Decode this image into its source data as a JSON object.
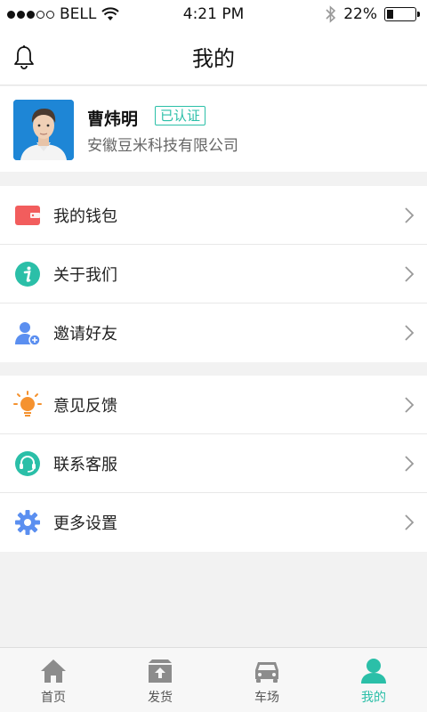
{
  "status_bar": {
    "carrier": "BELL",
    "time": "4:21 PM",
    "battery": "22%",
    "battery_level": 0.22
  },
  "header": {
    "title": "我的"
  },
  "profile": {
    "name": "曹炜明",
    "badge": "已认证",
    "company": "安徽豆米科技有限公司"
  },
  "menu": {
    "group1": [
      {
        "label": "我的钱包",
        "icon": "wallet-icon",
        "color": "#f25d5d"
      },
      {
        "label": "关于我们",
        "icon": "info-icon",
        "color": "#2bbfa8"
      },
      {
        "label": "邀请好友",
        "icon": "invite-user-icon",
        "color": "#5b8ff0"
      }
    ],
    "group2": [
      {
        "label": "意见反馈",
        "icon": "lightbulb-icon",
        "color": "#f5922f"
      },
      {
        "label": "联系客服",
        "icon": "headset-icon",
        "color": "#2bbfa8"
      },
      {
        "label": "更多设置",
        "icon": "gear-icon",
        "color": "#5b8ff0"
      }
    ]
  },
  "tabs": [
    {
      "label": "首页",
      "icon": "home-icon"
    },
    {
      "label": "发货",
      "icon": "shipment-icon"
    },
    {
      "label": "车场",
      "icon": "car-icon"
    },
    {
      "label": "我的",
      "icon": "user-icon",
      "active": true
    }
  ],
  "colors": {
    "accent": "#2bbfa8",
    "inactive_icon": "#8c8c8c"
  }
}
